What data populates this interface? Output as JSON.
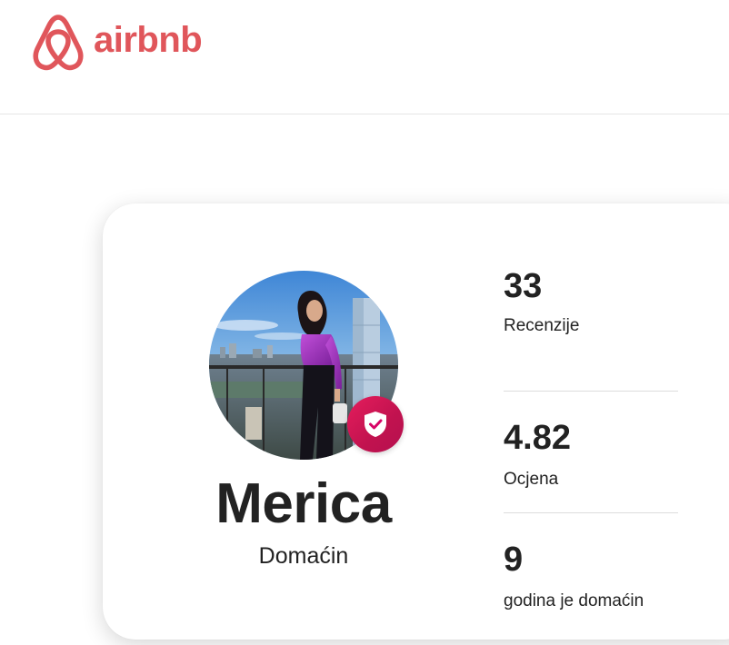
{
  "header": {
    "logo_text": "airbnb",
    "brand_color": "#E0565B"
  },
  "host_card": {
    "name": "Merica",
    "role": "Domaćin",
    "badge_icon": "shield-check-icon",
    "badge_color": "#D70466",
    "stats": [
      {
        "value": "33",
        "label": "Recenzije"
      },
      {
        "value": "4.82",
        "label": "Ocjena"
      },
      {
        "value": "9",
        "label": "godina je domaćin"
      }
    ]
  }
}
